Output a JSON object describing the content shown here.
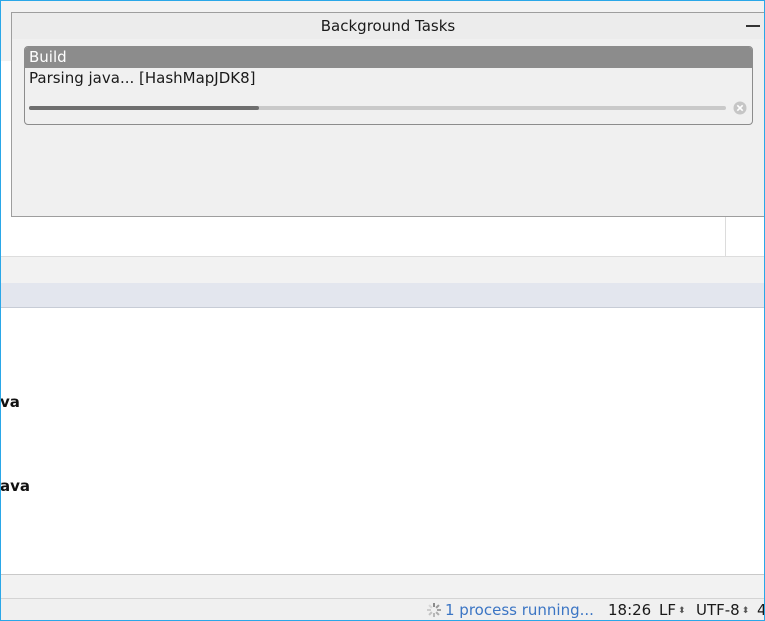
{
  "popup": {
    "title": "Background Tasks",
    "task": {
      "group_label": "Build",
      "description": "Parsing java... [HashMapJDK8]",
      "progress": 0.33
    }
  },
  "list": {
    "fragment_1": "va",
    "fragment_2": "ava"
  },
  "statusbar": {
    "process_label": "1 process running...",
    "time": "18:26",
    "line_separator": "LF",
    "encoding": "UTF-8",
    "more": "4"
  },
  "colors": {
    "accent": "#3b75c4",
    "task_header": "#8c8c8c",
    "frame": "#2aa7e8"
  },
  "icons": [
    "minimize-icon",
    "cancel-icon",
    "spinner-icon"
  ]
}
